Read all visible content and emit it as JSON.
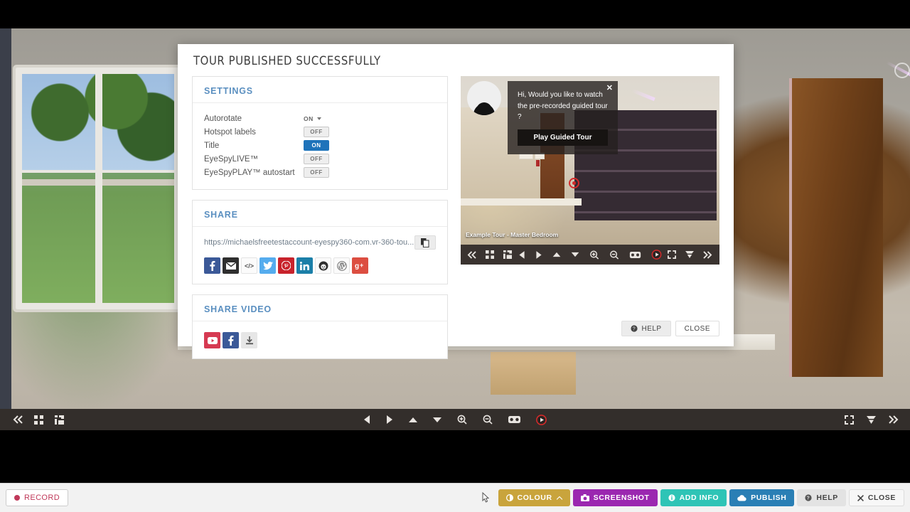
{
  "background": {
    "tour_title": "Example Tour - Master Bedroom",
    "viewer_toolbar": {
      "icons_left": [
        "collapse-left-icon",
        "grid-view-icon",
        "floorplan-icon"
      ],
      "icons_center": [
        "arrow-left-icon",
        "arrow-right-icon",
        "arrow-up-icon",
        "arrow-down-icon",
        "zoom-in-icon",
        "zoom-out-icon",
        "vr-goggles-icon",
        "record-play-icon"
      ],
      "icons_right": [
        "fullscreen-icon",
        "dropdown-icon",
        "expand-right-icon"
      ]
    }
  },
  "appbar": {
    "record_label": "RECORD",
    "buttons": [
      {
        "label": "COLOUR",
        "icon": "colour-icon",
        "color": "#c9a43c"
      },
      {
        "label": "SCREENSHOT",
        "icon": "camera-icon",
        "color": "#9b27b0"
      },
      {
        "label": "ADD INFO",
        "icon": "info-icon",
        "color": "#2ec4b6"
      },
      {
        "label": "PUBLISH",
        "icon": "cloud-icon",
        "color": "#2a7fb5"
      },
      {
        "label": "HELP",
        "icon": "help-icon",
        "color": "#e3e3e3"
      },
      {
        "label": "CLOSE",
        "icon": "close-x-icon",
        "color": "#f7f7f7"
      }
    ]
  },
  "modal": {
    "title": "TOUR PUBLISHED SUCCESSFULLY",
    "settings": {
      "heading": "SETTINGS",
      "rows": [
        {
          "label": "Autorotate",
          "control": "select",
          "value": "ON"
        },
        {
          "label": "Hotspot labels",
          "control": "toggle",
          "value": "OFF"
        },
        {
          "label": "Title",
          "control": "toggle",
          "value": "ON"
        },
        {
          "label": "EyeSpyLIVE™",
          "control": "toggle",
          "value": "OFF"
        },
        {
          "label": "EyeSpyPLAY™ autostart",
          "control": "toggle",
          "value": "OFF"
        }
      ]
    },
    "share": {
      "heading": "SHARE",
      "url": "https://michaelsfreetestaccount-eyespy360-com.vr-360-tou...",
      "copy_icon": "copy-icon",
      "networks": [
        {
          "name": "facebook",
          "glyph": "f",
          "color": "#3b5998"
        },
        {
          "name": "email",
          "glyph": "✉",
          "color": "#2f2f2f"
        },
        {
          "name": "embed-code",
          "glyph": "</>",
          "color": "#fbfbfb"
        },
        {
          "name": "twitter",
          "glyph": "t",
          "color": "#55acee"
        },
        {
          "name": "pinterest",
          "glyph": "P",
          "color": "#c8232c"
        },
        {
          "name": "linkedin",
          "glyph": "in",
          "color": "#1b7fa8"
        },
        {
          "name": "reddit",
          "glyph": "r",
          "color": "#fbfbfb"
        },
        {
          "name": "wordpress",
          "glyph": "W",
          "color": "#fbfbfb"
        },
        {
          "name": "googleplus",
          "glyph": "g+",
          "color": "#dc4e41"
        }
      ]
    },
    "share_video": {
      "heading": "SHARE VIDEO",
      "buttons": [
        {
          "name": "youtube",
          "color": "#d63a52"
        },
        {
          "name": "facebook",
          "color": "#3b5998"
        },
        {
          "name": "download",
          "color": "#e6e6e6"
        }
      ]
    },
    "preview": {
      "tour_title": "Example Tour - Master Bedroom",
      "popup": {
        "message": "Hi, Would you like to watch the pre-recorded guided tour ?",
        "button_label": "Play Guided Tour",
        "close_label": "✕"
      },
      "toolbar": {
        "icons_left": [
          "collapse-left-icon",
          "grid-view-icon",
          "floorplan-icon"
        ],
        "icons_center": [
          "arrow-left-icon",
          "arrow-right-icon",
          "arrow-up-icon",
          "arrow-down-icon",
          "zoom-in-icon",
          "zoom-out-icon",
          "vr-goggles-icon",
          "record-play-icon"
        ],
        "icons_right": [
          "fullscreen-icon",
          "dropdown-icon",
          "expand-right-icon"
        ]
      }
    },
    "footer": {
      "help_label": "HELP",
      "close_label": "CLOSE"
    }
  }
}
